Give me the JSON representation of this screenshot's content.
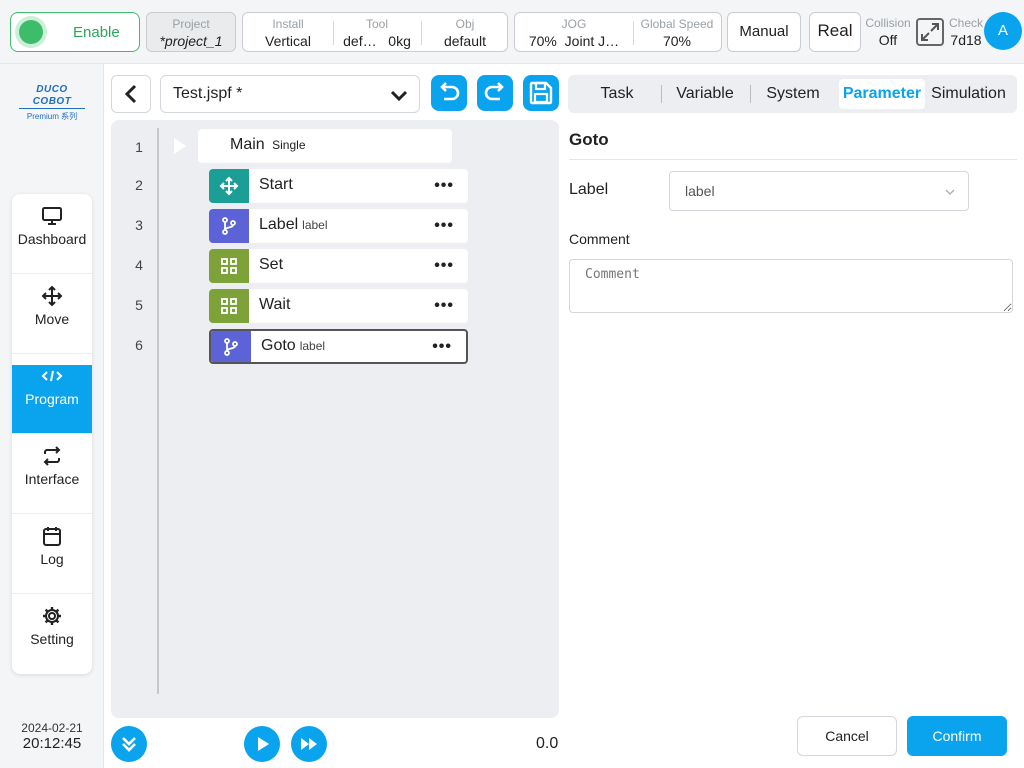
{
  "topbar": {
    "enable_label": "Enable",
    "project": {
      "caption": "Project",
      "value": "*project_1"
    },
    "install": {
      "caption": "Install",
      "value": "Vertical"
    },
    "tool": {
      "caption": "Tool",
      "name": "def…",
      "load": "0kg"
    },
    "obj": {
      "caption": "Obj",
      "value": "default"
    },
    "jog": {
      "caption": "JOG",
      "speed": "70%",
      "mode": "Joint J…"
    },
    "global_speed": {
      "caption": "Global Speed",
      "value": "70%"
    },
    "manual_label": "Manual",
    "real_label": "Real",
    "collision": {
      "caption": "Collision",
      "value": "Off"
    },
    "check": {
      "caption": "Check",
      "value": "7d18"
    },
    "avatar_letter": "A"
  },
  "brand": {
    "name": "DUCO COBOT",
    "sub": "Premium 系列"
  },
  "nav": {
    "items": [
      {
        "label": "Dashboard",
        "icon": "monitor-icon"
      },
      {
        "label": "Move",
        "icon": "move-icon"
      },
      {
        "label": "Program",
        "icon": "code-icon"
      },
      {
        "label": "Interface",
        "icon": "swap-icon"
      },
      {
        "label": "Log",
        "icon": "calendar-icon"
      },
      {
        "label": "Setting",
        "icon": "gear-icon"
      }
    ],
    "active": "Program"
  },
  "clock": {
    "date": "2024-02-21",
    "time": "20:12:45"
  },
  "editor": {
    "file_name": "Test.jspf *",
    "rows": [
      {
        "num": "1",
        "name": "Main",
        "tag": "Single"
      },
      {
        "num": "2",
        "name": "Start",
        "tag": ""
      },
      {
        "num": "3",
        "name": "Label",
        "tag": "label"
      },
      {
        "num": "4",
        "name": "Set",
        "tag": ""
      },
      {
        "num": "5",
        "name": "Wait",
        "tag": ""
      },
      {
        "num": "6",
        "name": "Goto",
        "tag": "label"
      }
    ],
    "more": "•••",
    "progress_value": "0.0"
  },
  "tabs": [
    "Task",
    "Variable",
    "System",
    "Parameter",
    "Simulation"
  ],
  "active_tab": "Parameter",
  "panel": {
    "title": "Goto",
    "label_caption": "Label",
    "label_value": "label",
    "comment_caption": "Comment",
    "comment_placeholder": "Comment",
    "cancel": "Cancel",
    "confirm": "Confirm"
  },
  "colors": {
    "accent": "#0aa3ee",
    "teal": "#1a9e96",
    "purple": "#5b63d6",
    "olive": "#7da23a",
    "enable_green": "#3dbd6a"
  }
}
